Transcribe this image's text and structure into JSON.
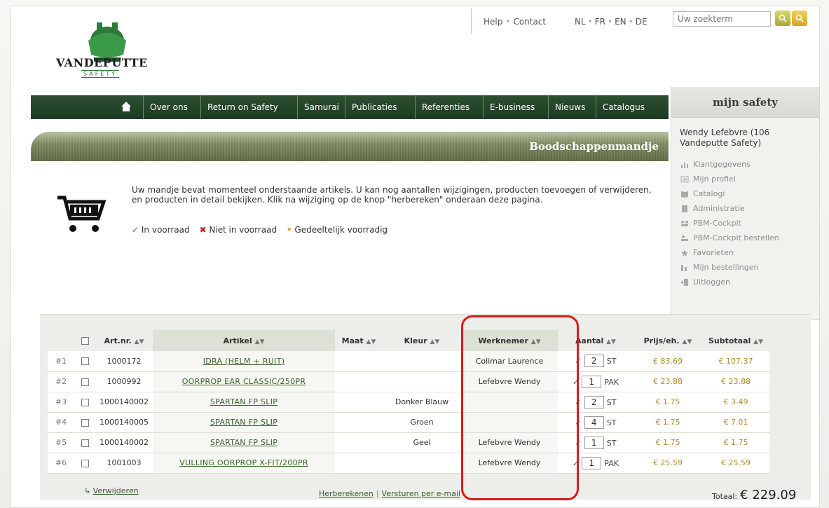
{
  "brand": {
    "logo_text": "VANDEPUTTE",
    "logo_sub": "SAFETY"
  },
  "header": {
    "links": [
      "Help",
      "Contact"
    ],
    "languages": [
      "NL",
      "FR",
      "EN",
      "DE"
    ],
    "search_placeholder": "Uw zoekterm"
  },
  "nav": {
    "items": [
      "Over ons",
      "Return on Safety",
      "Samurai",
      "Publicaties",
      "Referenties",
      "E-business",
      "Nieuws",
      "Catalogus"
    ]
  },
  "mijn": {
    "title": "mijn safety",
    "user": "Wendy Lefebvre (106 Vandeputte Safety)",
    "menu": [
      {
        "label": "Klantgegevens",
        "icon": "chart-icon"
      },
      {
        "label": "Mijn profiel",
        "icon": "profile-icon"
      },
      {
        "label": "Catalogi",
        "icon": "book-icon"
      },
      {
        "label": "Administratie",
        "icon": "document-icon"
      },
      {
        "label": "PBM-Cockpit",
        "icon": "cockpit-icon"
      },
      {
        "label": "PBM-Cockpit bestellen",
        "icon": "order-icon"
      },
      {
        "label": "Favorieten",
        "icon": "star-icon"
      },
      {
        "label": "Mijn bestellingen",
        "icon": "list-icon"
      },
      {
        "label": "Uitloggen",
        "icon": "logout-icon"
      }
    ]
  },
  "page": {
    "title": "Boodschappenmandje",
    "intro": "Uw mandje bevat momenteel onderstaande artikels. U kan nog aantallen wijzigingen, producten toevoegen of verwijderen, en producten in detail bekijken. Klik na wijziging op de knop \"herbereken\" onderaan deze pagina.",
    "legend": {
      "in_stock": "In voorraad",
      "not_in_stock": "Niet in voorraad",
      "partial": "Gedeeltelijk voorradig"
    }
  },
  "table": {
    "headers": {
      "artnr": "Art.nr.",
      "artikel": "Artikel",
      "maat": "Maat",
      "kleur": "Kleur",
      "werknemer": "Werknemer",
      "aantal": "Aantal",
      "prijs": "Prijs/eh.",
      "subtotaal": "Subtotaal"
    },
    "rows": [
      {
        "nr": "#1",
        "artnr": "1000172",
        "artikel": "IDRA (HELM + RUIT)",
        "maat": "",
        "kleur": "",
        "werknemer": "Colimar Laurence",
        "qty": "2",
        "unit": "ST",
        "price": "€ 83.69",
        "subtotal": "€ 107.37"
      },
      {
        "nr": "#2",
        "artnr": "1000992",
        "artikel": "OORPROP EAR CLASSIC/250PR",
        "maat": "",
        "kleur": "",
        "werknemer": "Lefebvre Wendy",
        "qty": "1",
        "unit": "PAK",
        "price": "€ 23.88",
        "subtotal": "€ 23.88"
      },
      {
        "nr": "#3",
        "artnr": "1000140002",
        "artikel": "SPARTAN FP SLIP",
        "maat": "",
        "kleur": "Donker Blauw",
        "werknemer": "",
        "qty": "2",
        "unit": "ST",
        "price": "€ 1.75",
        "subtotal": "€ 3.49"
      },
      {
        "nr": "#4",
        "artnr": "1000140005",
        "artikel": "SPARTAN FP SLIP",
        "maat": "",
        "kleur": "Groen",
        "werknemer": "",
        "qty": "4",
        "unit": "ST",
        "price": "€ 1.75",
        "subtotal": "€ 7.01"
      },
      {
        "nr": "#5",
        "artnr": "1000140002",
        "artikel": "SPARTAN FP SLIP",
        "maat": "",
        "kleur": "Geel",
        "werknemer": "Lefebvre Wendy",
        "qty": "1",
        "unit": "ST",
        "price": "€ 1.75",
        "subtotal": "€ 1.75"
      },
      {
        "nr": "#6",
        "artnr": "1001003",
        "artikel": "VULLING OORPROP X-FIT/200PR",
        "maat": "",
        "kleur": "",
        "werknemer": "Lefebvre Wendy",
        "qty": "1",
        "unit": "PAK",
        "price": "€ 25.59",
        "subtotal": "€ 25.59"
      }
    ]
  },
  "footer": {
    "remove": "Verwijderen",
    "recalc": "Herberekenen",
    "email": "Versturen per e-mail",
    "total_label": "Totaal:",
    "total_value": "€ 229.09"
  },
  "colors": {
    "nav_bg": "#1d3a22",
    "link": "#3a5f2e",
    "price": "#b08c2a",
    "highlight": "#e01818"
  }
}
